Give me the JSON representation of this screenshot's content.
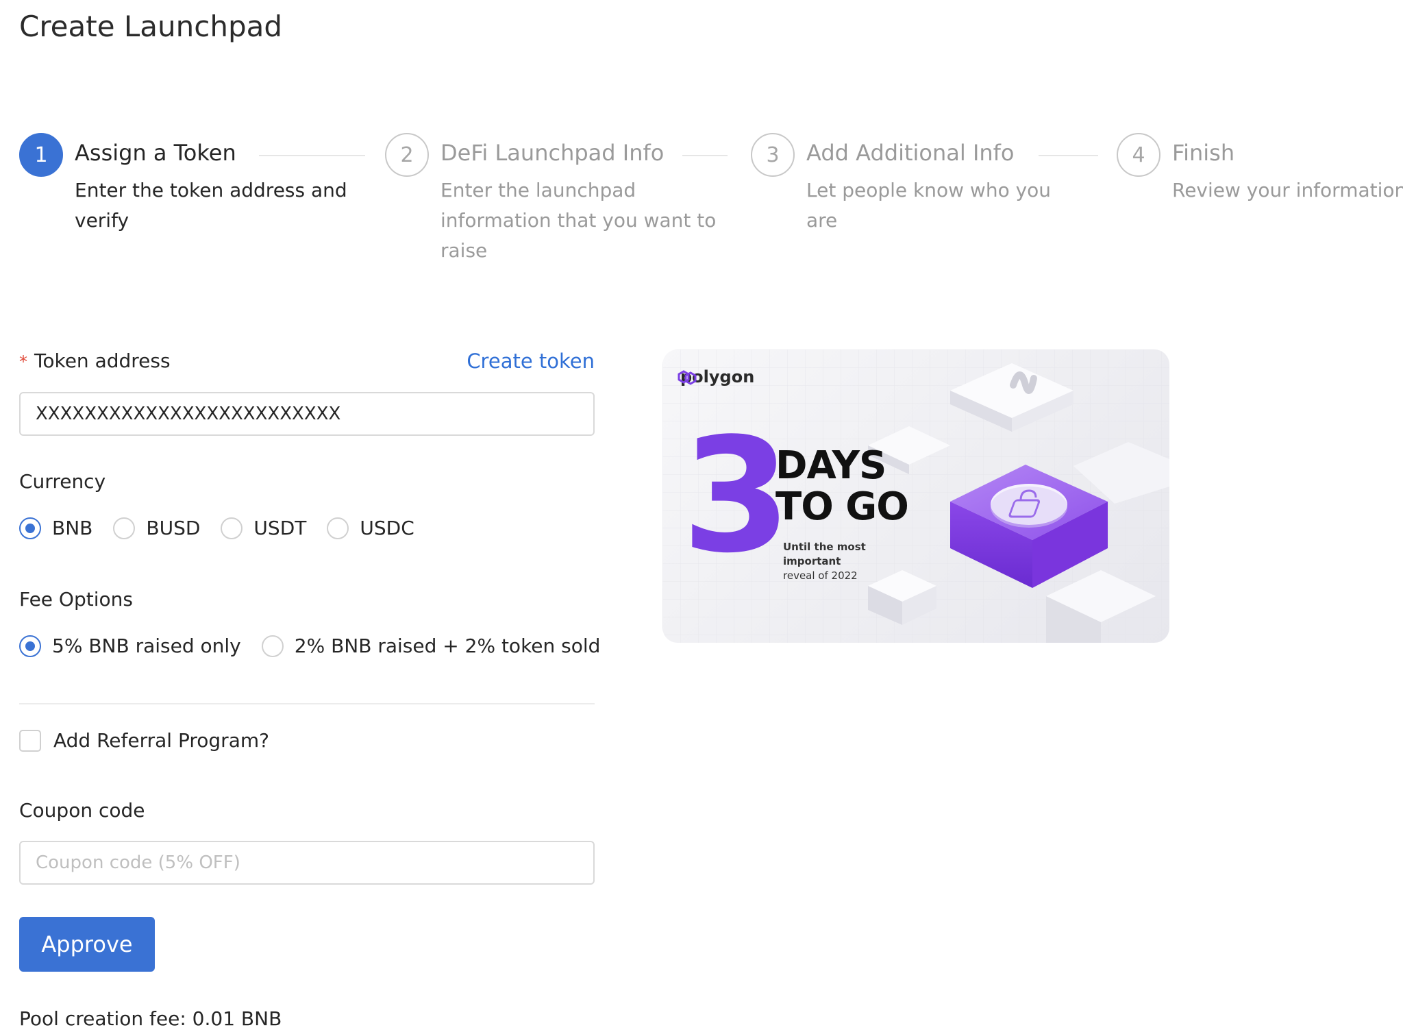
{
  "page": {
    "title": "Create Launchpad"
  },
  "steps": [
    {
      "number": "1",
      "title": "Assign a Token",
      "description": "Enter the token address and verify",
      "active": true
    },
    {
      "number": "2",
      "title": "DeFi Launchpad Info",
      "description": "Enter the launchpad information that you want to raise",
      "active": false
    },
    {
      "number": "3",
      "title": "Add Additional Info",
      "description": "Let people know who you are",
      "active": false
    },
    {
      "number": "4",
      "title": "Finish",
      "description": "Review your information",
      "active": false
    }
  ],
  "form": {
    "token_address": {
      "required_mark": "*",
      "label": "Token address",
      "create_link": "Create token",
      "value": "XXXXXXXXXXXXXXXXXXXXXXXXX"
    },
    "currency": {
      "label": "Currency",
      "options": [
        "BNB",
        "BUSD",
        "USDT",
        "USDC"
      ],
      "selected": "BNB"
    },
    "fee_options": {
      "label": "Fee Options",
      "options": [
        "5% BNB raised only",
        "2% BNB raised + 2% token sold"
      ],
      "selected": "5% BNB raised only"
    },
    "referral": {
      "label": "Add Referral Program?",
      "checked": false
    },
    "coupon": {
      "label": "Coupon code",
      "placeholder": "Coupon code (5% OFF)",
      "value": ""
    },
    "approve_label": "Approve",
    "pool_fee": "Pool creation fee: 0.01 BNB"
  },
  "banner": {
    "brand": "polygon",
    "big_number": "3",
    "headline_line1": "DAYS",
    "headline_line2": "TO GO",
    "subtext_line1": "Until the most important",
    "subtext_line2": "reveal of 2022",
    "accent_color": "#7b3fe4",
    "icon": "lock-icon"
  },
  "colors": {
    "primary": "#3a72d4",
    "link": "#2f6fd6",
    "required": "#e04a3a"
  }
}
